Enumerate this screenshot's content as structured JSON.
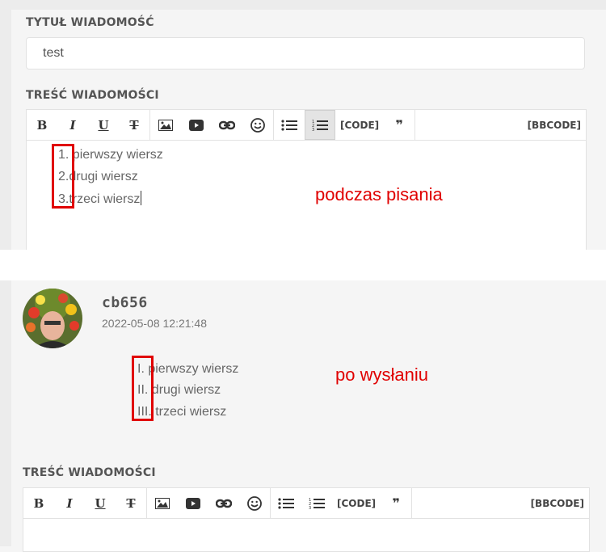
{
  "form_top": {
    "title_label": "TYTUŁ WIADOMOŚĆ",
    "title_value": "test",
    "content_label": "TREŚĆ WIADOMOŚCI"
  },
  "toolbar": {
    "bold": "B",
    "italic": "I",
    "underline": "U",
    "strike": "T",
    "code": "[CODE]",
    "quote": "❞",
    "bbcode": "[BBCODE]"
  },
  "editor_list": {
    "numbers": [
      "1.",
      "2.",
      "3."
    ],
    "items": [
      " pierwszy wiersz",
      "drugi wiersz",
      "trzeci wiersz"
    ]
  },
  "annotations": {
    "while_typing": "podczas pisania",
    "after_sending": "po wysłaniu"
  },
  "post": {
    "author": "cb656",
    "date": "2022-05-08 12:21:48",
    "numbers": [
      "I.",
      "II.",
      "III."
    ],
    "items": [
      " pierwszy wiersz",
      "drugi wiersz",
      " trzeci wiersz"
    ]
  },
  "form_bottom": {
    "content_label": "TREŚĆ WIADOMOŚCI"
  },
  "colors": {
    "annotation_red": "#e00000",
    "border": "#e2e2e2"
  }
}
